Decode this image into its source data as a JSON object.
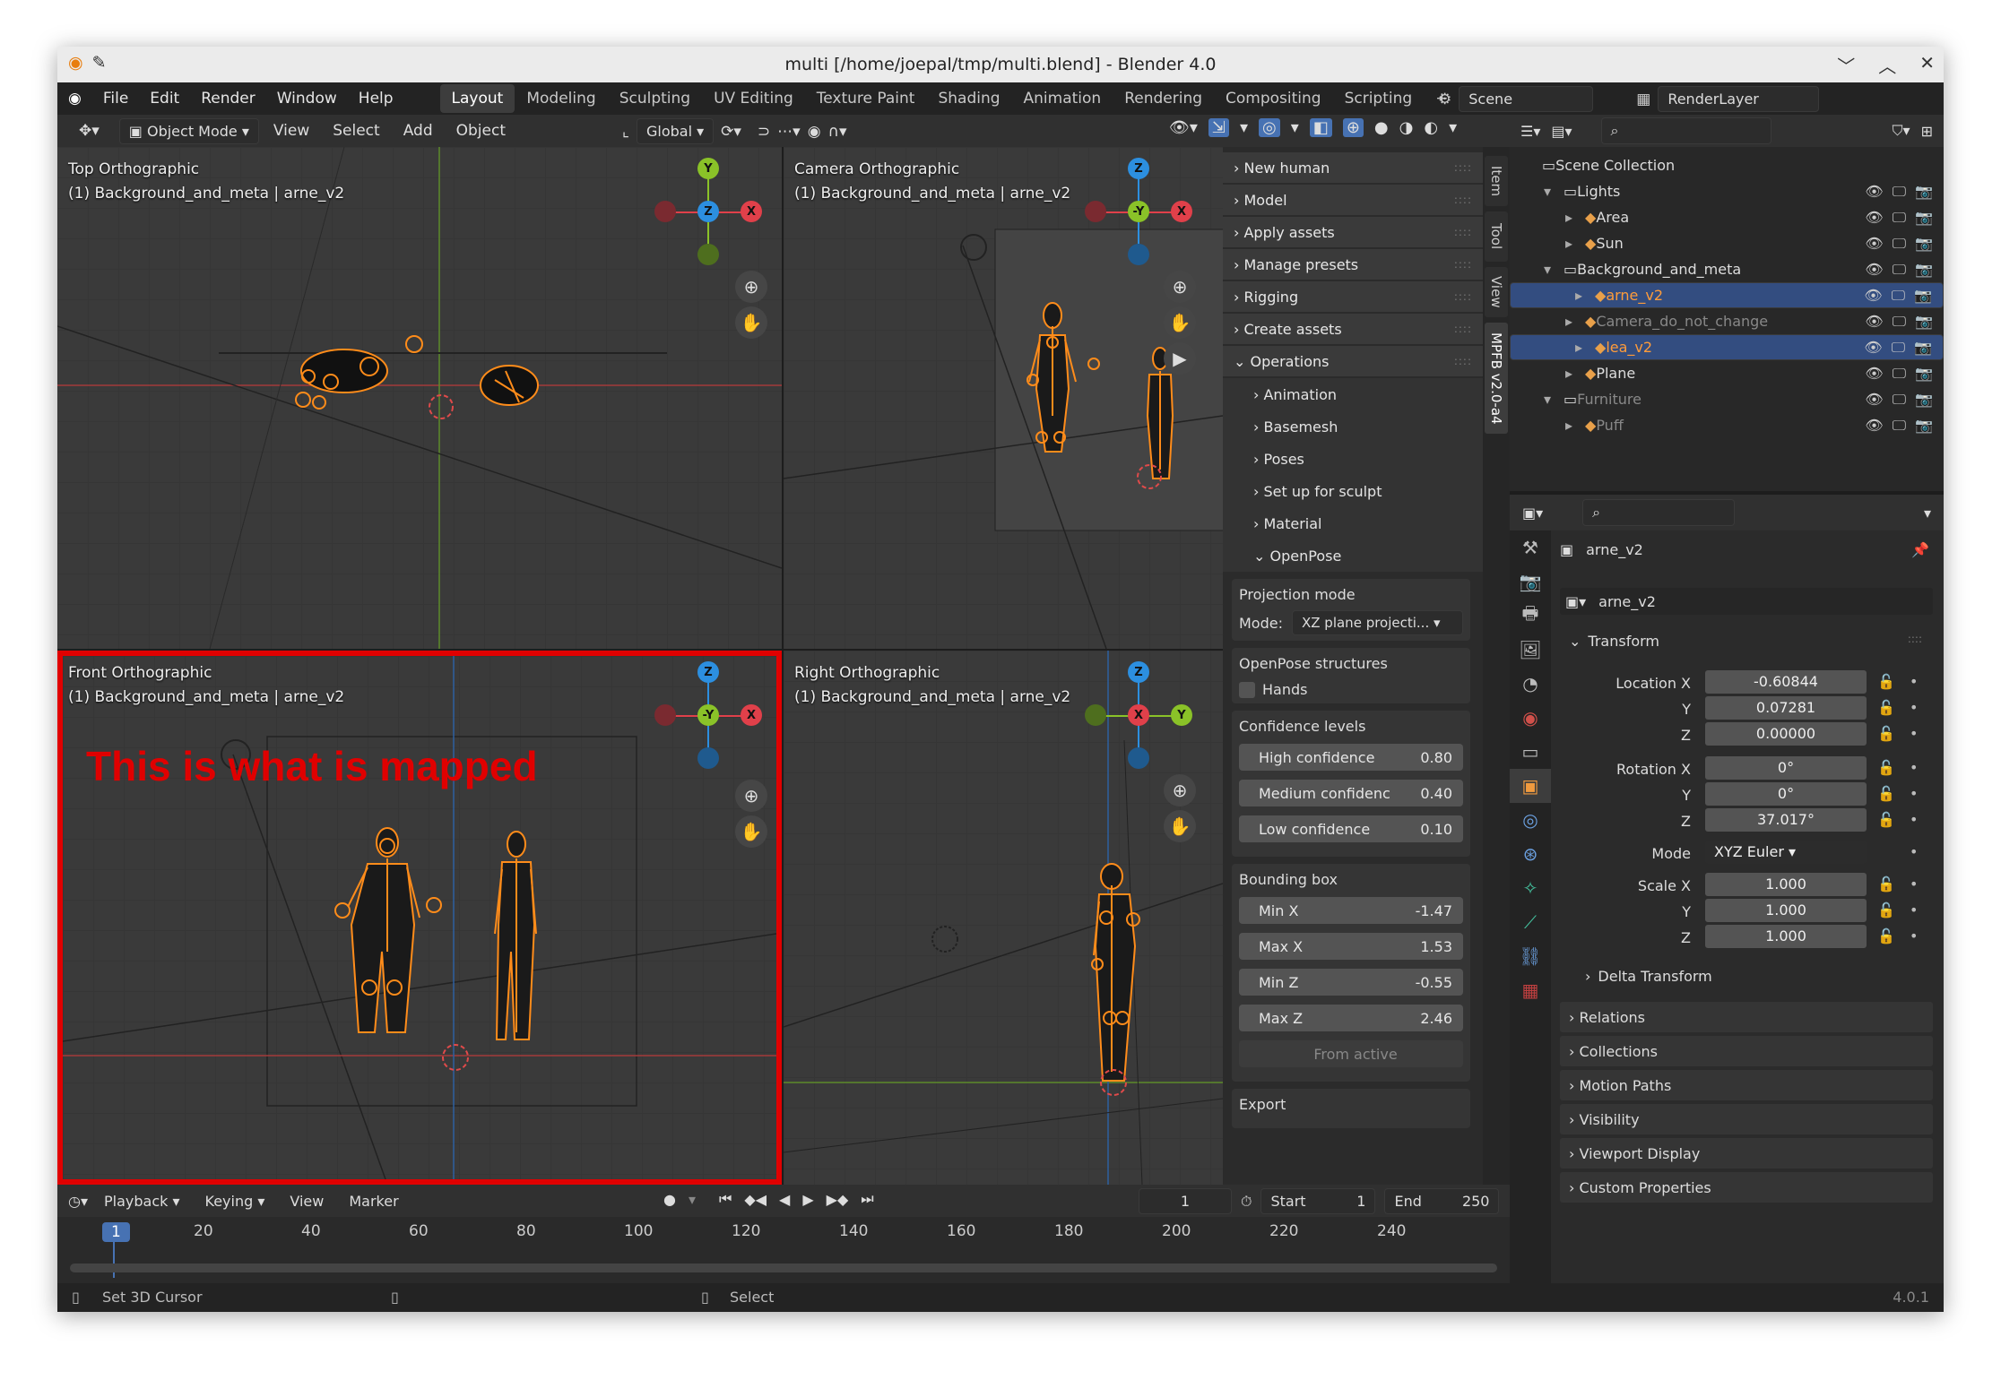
{
  "window": {
    "title": "multi [/home/joepal/tmp/multi.blend] - Blender 4.0",
    "controls": [
      "﹀",
      "︿",
      "✕"
    ]
  },
  "menu": {
    "items": [
      "File",
      "Edit",
      "Render",
      "Window",
      "Help"
    ],
    "workspaces": [
      "Layout",
      "Modeling",
      "Sculpting",
      "UV Editing",
      "Texture Paint",
      "Shading",
      "Animation",
      "Rendering",
      "Compositing",
      "Scripting"
    ],
    "active_workspace": "Layout",
    "scene": "Scene",
    "view_layer": "RenderLayer",
    "add_tab": "+"
  },
  "viewport_header": {
    "mode": "Object Mode",
    "menus": [
      "View",
      "Select",
      "Add",
      "Object"
    ],
    "transform": "Global"
  },
  "viewports": {
    "top": {
      "title": "Top Orthographic",
      "subtitle": "(1) Background_and_meta | arne_v2"
    },
    "camera": {
      "title": "Camera Orthographic",
      "subtitle": "(1) Background_and_meta | arne_v2"
    },
    "front": {
      "title": "Front Orthographic",
      "subtitle": "(1) Background_and_meta | arne_v2",
      "annotation": "This is what is mapped"
    },
    "right": {
      "title": "Right Orthographic",
      "subtitle": "(1) Background_and_meta | arne_v2"
    }
  },
  "gizmo_labels": {
    "x": "X",
    "y": "Y",
    "z": "Z",
    "neg_y": "-Y"
  },
  "mpfb": {
    "panels": [
      "New human",
      "Model",
      "Apply assets",
      "Manage presets",
      "Rigging",
      "Create assets",
      "Operations"
    ],
    "operations": [
      "Animation",
      "Basemesh",
      "Poses",
      "Set up for sculpt",
      "Material",
      "OpenPose"
    ],
    "projection": {
      "title": "Projection mode",
      "mode_label": "Mode:",
      "mode_value": "XZ plane projecti..."
    },
    "structures": {
      "title": "OpenPose structures",
      "hands": "Hands"
    },
    "confidence": {
      "title": "Confidence levels",
      "rows": [
        {
          "label": "High confidence",
          "value": "0.80"
        },
        {
          "label": "Medium confidenc",
          "value": "0.40"
        },
        {
          "label": "Low confidence",
          "value": "0.10"
        }
      ]
    },
    "bbox": {
      "title": "Bounding box",
      "rows": [
        {
          "label": "Min X",
          "value": "-1.47"
        },
        {
          "label": "Max X",
          "value": "1.53"
        },
        {
          "label": "Min Z",
          "value": "-0.55"
        },
        {
          "label": "Max Z",
          "value": "2.46"
        }
      ],
      "from_active": "From active"
    },
    "export": "Export"
  },
  "side_tabs": [
    "Item",
    "Tool",
    "View",
    "MPFB v2.0-a4"
  ],
  "outliner": {
    "rows": [
      {
        "name": "Scene Collection",
        "indent": 0,
        "sel": false,
        "dim": false
      },
      {
        "name": "Lights",
        "indent": 1,
        "sel": false,
        "dim": false
      },
      {
        "name": "Area",
        "indent": 2,
        "sel": false,
        "dim": false
      },
      {
        "name": "Sun",
        "indent": 2,
        "sel": false,
        "dim": false
      },
      {
        "name": "Background_and_meta",
        "indent": 1,
        "sel": false,
        "dim": false
      },
      {
        "name": "arne_v2",
        "indent": 2,
        "sel": true,
        "dim": false
      },
      {
        "name": "Camera_do_not_change",
        "indent": 2,
        "sel": false,
        "dim": true
      },
      {
        "name": "lea_v2",
        "indent": 2,
        "sel": true,
        "dim": false
      },
      {
        "name": "Plane",
        "indent": 2,
        "sel": false,
        "dim": false
      },
      {
        "name": "Furniture",
        "indent": 1,
        "sel": false,
        "dim": true
      },
      {
        "name": "Puff",
        "indent": 2,
        "sel": false,
        "dim": true
      }
    ]
  },
  "properties": {
    "object_name": "arne_v2",
    "data_name": "arne_v2",
    "transform": "Transform",
    "location": {
      "label": "Location X",
      "x": "-0.60844",
      "y": "0.07281",
      "z": "0.00000"
    },
    "rotation": {
      "label": "Rotation X",
      "x": "0°",
      "y": "0°",
      "z": "37.017°"
    },
    "mode": {
      "label": "Mode",
      "value": "XYZ Euler"
    },
    "scale": {
      "label": "Scale X",
      "x": "1.000",
      "y": "1.000",
      "z": "1.000"
    },
    "axis_y": "Y",
    "axis_z": "Z",
    "delta": "Delta Transform",
    "sections": [
      "Relations",
      "Collections",
      "Motion Paths",
      "Visibility",
      "Viewport Display",
      "Custom Properties"
    ]
  },
  "timeline": {
    "menus": [
      "Playback",
      "Keying",
      "View",
      "Marker"
    ],
    "current_frame": "1",
    "start_label": "Start",
    "start": "1",
    "end_label": "End",
    "end": "250",
    "ruler": [
      "1",
      "20",
      "40",
      "60",
      "80",
      "100",
      "120",
      "140",
      "160",
      "180",
      "200",
      "220",
      "240"
    ]
  },
  "status": {
    "left": "Set 3D Cursor",
    "middle": "Select",
    "version": "4.0.1"
  },
  "colors": {
    "selection_outline": "#e00000",
    "armature": "#ff8c1a",
    "x_axis": "#e0404a",
    "y_axis": "#8ac228",
    "z_axis": "#2c8fe0"
  }
}
